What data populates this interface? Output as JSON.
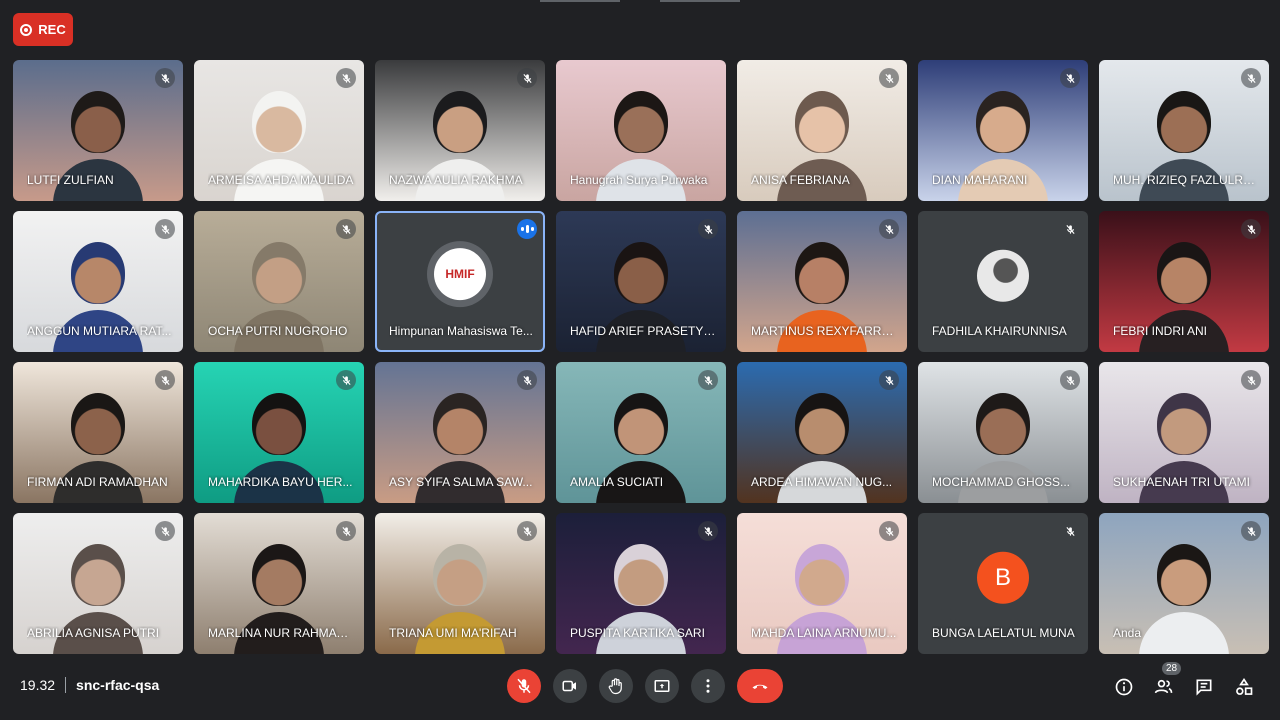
{
  "recording": {
    "label": "REC",
    "color": "#d93025"
  },
  "meeting": {
    "time": "19.32",
    "code": "snc-rfac-qsa"
  },
  "participants_count": "28",
  "participants": [
    {
      "name": "LUTFI ZULFIAN",
      "bg": [
        "#5b6d8c",
        "#c79a8a"
      ],
      "skin": "#8a5f4a",
      "hair": "#1e1a18",
      "cloth": "#2b3540",
      "muted": true
    },
    {
      "name": "ARMEISA AHDA MAULIDA",
      "bg": [
        "#e8e6e4",
        "#d9d4cf"
      ],
      "skin": "#d9b9a0",
      "hair": "#f3f3f1",
      "cloth": "#f5f5f3",
      "muted": true
    },
    {
      "name": "NAZWA AULIA RAKHMA",
      "bg": [
        "#3a3b3d",
        "#f1efec"
      ],
      "skin": "#c99f82",
      "hair": "#1b1b1d",
      "cloth": "#efefee",
      "muted": true
    },
    {
      "name": "Hanugrah Surya Purwaka",
      "bg": [
        "#e8c9cf",
        "#c9a5a1"
      ],
      "skin": "#9a7059",
      "hair": "#1c1715",
      "cloth": "#dfe3e8",
      "muted": false
    },
    {
      "name": "ANISA FEBRIANA",
      "bg": [
        "#f1ece6",
        "#d8cbbd"
      ],
      "skin": "#e6c2a8",
      "hair": "#6d5a4e",
      "cloth": "#6e5c52",
      "muted": true
    },
    {
      "name": "DIAN MAHARANI",
      "bg": [
        "#2e3e78",
        "#c9d3ea"
      ],
      "skin": "#d7ab8c",
      "hair": "#2a2320",
      "cloth": "#e4cbb4",
      "muted": true
    },
    {
      "name": "MUH. RIZIEQ FAZLULRA...",
      "bg": [
        "#e4e8ec",
        "#b9c3cc"
      ],
      "skin": "#9c6f55",
      "hair": "#191715",
      "cloth": "#3f4a55",
      "muted": true
    },
    {
      "name": "ANGGUN MUTIARA RAT...",
      "bg": [
        "#f2f2f2",
        "#d7d9dc"
      ],
      "skin": "#b78769",
      "hair": "#273a73",
      "cloth": "#2f4585",
      "muted": true
    },
    {
      "name": "OCHA PUTRI NUGROHO",
      "bg": [
        "#b8ad98",
        "#8e8675"
      ],
      "skin": "#c39f85",
      "hair": "#857a69",
      "cloth": "#7f7463",
      "muted": true
    },
    {
      "name": "Himpunan Mahasiswa Te...",
      "bg": [
        "#3c4043",
        "#3c4043"
      ],
      "logo": "HMIF",
      "muted": false,
      "speaking": true
    },
    {
      "name": "HAFID ARIEF PRASETYO -",
      "bg": [
        "#2d3956",
        "#1b2233"
      ],
      "skin": "#8a5f48",
      "hair": "#1a1413",
      "cloth": "#1e2026",
      "muted": true
    },
    {
      "name": "MARTINUS REXYFARREL...",
      "bg": [
        "#5d6f93",
        "#d2a58c"
      ],
      "skin": "#b78066",
      "hair": "#1d1714",
      "cloth": "#e8631f",
      "muted": true
    },
    {
      "name": "FADHILA KHAIRUNNISA",
      "bg": [
        "#3c4043",
        "#3c4043"
      ],
      "avatar_photo": true,
      "muted": true
    },
    {
      "name": "FEBRI INDRI ANI",
      "bg": [
        "#3a1019",
        "#c23a43"
      ],
      "skin": "#b78466",
      "hair": "#1a1515",
      "cloth": "#272022",
      "muted": true
    },
    {
      "name": "FIRMAN ADI RAMADHAN",
      "bg": [
        "#efe6db",
        "#8a7562"
      ],
      "skin": "#8c624b",
      "hair": "#1a1715",
      "cloth": "#2e2d2c",
      "muted": true
    },
    {
      "name": "MAHARDIKA BAYU HER...",
      "bg": [
        "#26d4b4",
        "#0f9c83"
      ],
      "skin": "#7a5040",
      "hair": "#141211",
      "cloth": "#1b3347",
      "muted": true
    },
    {
      "name": "ASY SYIFA SALMA SAW...",
      "bg": [
        "#647494",
        "#c99c84"
      ],
      "skin": "#b48468",
      "hair": "#2a2422",
      "cloth": "#312c2e",
      "muted": true
    },
    {
      "name": "AMALIA SUCIATI",
      "bg": [
        "#86b7b8",
        "#5f9498"
      ],
      "skin": "#c19478",
      "hair": "#161414",
      "cloth": "#181616",
      "muted": true
    },
    {
      "name": "ARDEA HIMAWAN NUG...",
      "bg": [
        "#2b6bb0",
        "#52331f"
      ],
      "skin": "#b88d6e",
      "hair": "#171413",
      "cloth": "#d6d8da",
      "muted": true
    },
    {
      "name": "MOCHAMMAD GHOSS...",
      "bg": [
        "#dfe3e6",
        "#8a8f93"
      ],
      "skin": "#9a6e56",
      "hair": "#1e1a18",
      "cloth": "#9c9ea0",
      "muted": true
    },
    {
      "name": "SUKHAENAH TRI UTAMI",
      "bg": [
        "#e9e6ea",
        "#bfb3c3"
      ],
      "skin": "#c29a7e",
      "hair": "#3f3547",
      "cloth": "#463a4f",
      "muted": true
    },
    {
      "name": "ABRILIA AGNISA PUTRI",
      "bg": [
        "#eeeeee",
        "#d6d2cf"
      ],
      "skin": "#c6a692",
      "hair": "#5a4f4a",
      "cloth": "#5a4f4a",
      "muted": true
    },
    {
      "name": "MARLINA NUR RAHMAW...",
      "bg": [
        "#e3ddd5",
        "#8e7f6f"
      ],
      "skin": "#a47b62",
      "hair": "#1b1716",
      "cloth": "#221d1c",
      "muted": true
    },
    {
      "name": "TRIANA UMI MA'RIFAH",
      "bg": [
        "#f2eee8",
        "#8a6a4a"
      ],
      "skin": "#c59f84",
      "hair": "#b8b3a6",
      "cloth": "#c49a33",
      "muted": true
    },
    {
      "name": "PUSPITA KARTIKA SARI",
      "bg": [
        "#1c1f3a",
        "#43264f"
      ],
      "skin": "#c39c80",
      "hair": "#d9d1d8",
      "cloth": "#ced2da",
      "muted": true
    },
    {
      "name": "MAHDA LAINA ARNUMU...",
      "bg": [
        "#f5ded8",
        "#e9c9c1"
      ],
      "skin": "#d1a98d",
      "hair": "#c8a6d8",
      "cloth": "#c7a3d6",
      "muted": true
    },
    {
      "name": "BUNGA LAELATUL MUNA",
      "bg": [
        "#3c4043",
        "#3c4043"
      ],
      "initial": "B",
      "initial_color": "#f4511e",
      "muted": true
    },
    {
      "name": "Anda",
      "bg": [
        "#8ea5bf",
        "#c8bfb4"
      ],
      "skin": "#c99c7d",
      "hair": "#1b1715",
      "cloth": "#eceef0",
      "muted": true
    }
  ],
  "controls": {
    "mic": "mic-off-icon",
    "camera": "camera-icon",
    "raise_hand": "raise-hand-icon",
    "present": "present-screen-icon",
    "more": "more-options-icon",
    "end_call": "end-call-icon"
  },
  "right_controls": [
    "info-icon",
    "people-icon",
    "chat-icon",
    "activities-icon"
  ],
  "colors": {
    "background": "#202124",
    "red": "#ea4335",
    "active_border": "#8ab4f8",
    "speaking": "#1a73e8"
  }
}
